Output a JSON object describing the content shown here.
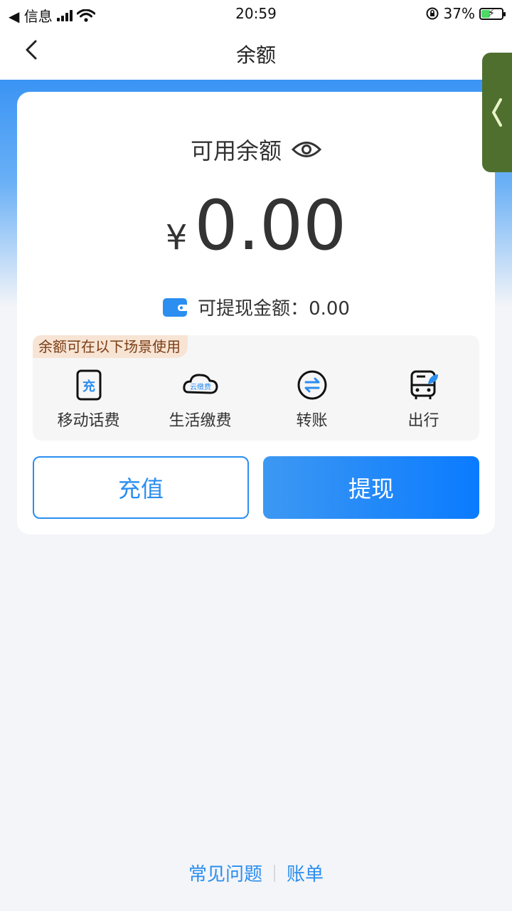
{
  "status_bar": {
    "back_app": "◀ 信息",
    "time": "20:59",
    "battery_percent": "37%"
  },
  "nav": {
    "title": "余额"
  },
  "balance": {
    "label": "可用余额",
    "currency": "¥",
    "amount": "0.00",
    "withdrawable_label": "可提现金额：",
    "withdrawable_value": "0.00"
  },
  "scenes": {
    "tag": "余额可在以下场景使用",
    "items": [
      {
        "label": "移动话费",
        "icon": "phone-recharge-icon",
        "icon_text": "充"
      },
      {
        "label": "生活缴费",
        "icon": "cloud-pay-icon",
        "icon_text": "云缴费"
      },
      {
        "label": "转账",
        "icon": "transfer-icon"
      },
      {
        "label": "出行",
        "icon": "bus-icon"
      }
    ]
  },
  "actions": {
    "recharge": "充值",
    "withdraw": "提现"
  },
  "footer": {
    "faq": "常见问题",
    "bill": "账单"
  },
  "colors": {
    "accent": "#2b8ef0",
    "hero_top": "#3a94f4",
    "tag_bg": "#f7e4d4",
    "tag_text": "#7a3d14",
    "side_tab": "#4f6f2f"
  }
}
